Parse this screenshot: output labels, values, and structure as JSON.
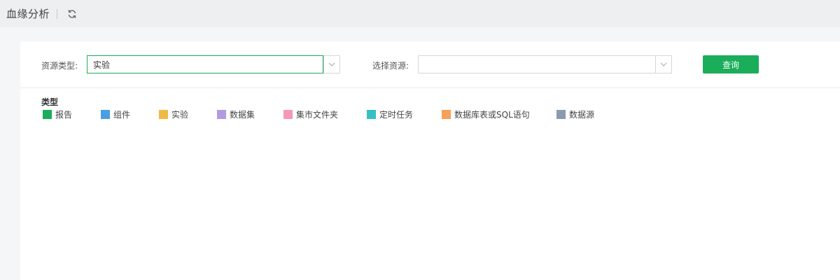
{
  "header": {
    "title": "血缘分析",
    "refresh_icon": "refresh-icon"
  },
  "filters": {
    "resource_type_label": "资源类型:",
    "resource_type_value": "实验",
    "select_resource_label": "选择资源:",
    "select_resource_value": "",
    "query_label": "查询"
  },
  "legend": {
    "title": "类型",
    "items": [
      {
        "label": "报告",
        "color": "#1aad5a"
      },
      {
        "label": "组件",
        "color": "#4a9fe0"
      },
      {
        "label": "实验",
        "color": "#f0b944"
      },
      {
        "label": "数据集",
        "color": "#b39be0"
      },
      {
        "label": "集市文件夹",
        "color": "#f497bb"
      },
      {
        "label": "定时任务",
        "color": "#36bfc0"
      },
      {
        "label": "数据库表或SQL语句",
        "color": "#f5a15a"
      },
      {
        "label": "数据源",
        "color": "#8a9bb0"
      }
    ]
  },
  "colors": {
    "accent": "#1aad5a"
  }
}
